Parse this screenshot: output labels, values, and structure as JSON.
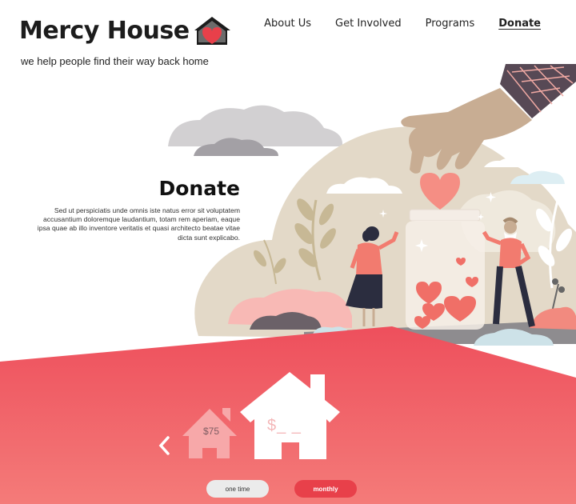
{
  "brand": {
    "name": "Mercy House",
    "tagline": "we help people find their way back home",
    "logo_icon": "house-heart-icon"
  },
  "nav": {
    "items": [
      "About Us",
      "Get Involved",
      "Programs",
      "Donate"
    ],
    "active": "Donate"
  },
  "donate": {
    "title": "Donate",
    "body": "Sed ut perspiciatis unde omnis iste natus error sit voluptatem accusantium doloremque laudantium, totam rem aperiam, eaque ipsa quae ab illo inventore veritatis et quasi architecto beatae vitae dicta sunt explicabo."
  },
  "amounts": {
    "small": "$75",
    "big": "$_ _"
  },
  "frequency": {
    "one_time": "one time",
    "monthly": "monthly",
    "selected": "monthly"
  },
  "colors": {
    "accent": "#e8404a",
    "coral": "#f06f67",
    "beige": "#e3d9c8",
    "dark": "#1c1c1c"
  }
}
